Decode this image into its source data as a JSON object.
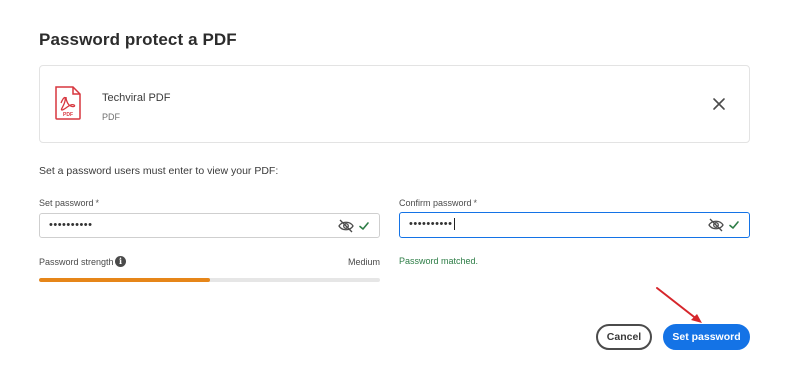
{
  "dialog": {
    "title": "Password protect a PDF"
  },
  "file": {
    "name": "Techviral PDF",
    "type": "PDF",
    "icon": "pdf-file-icon"
  },
  "instruction": "Set a password users must enter to view your PDF:",
  "set_password": {
    "label": "Set password",
    "required_mark": "*",
    "value": "••••••••••",
    "valid": true
  },
  "confirm_password": {
    "label": "Confirm password",
    "required_mark": "*",
    "value": "••••••••••",
    "focused": true,
    "valid": true
  },
  "strength": {
    "label": "Password strength",
    "info_icon": "i",
    "value_label": "Medium",
    "level": 0.5
  },
  "match_message": "Password matched.",
  "buttons": {
    "cancel": "Cancel",
    "submit": "Set password"
  },
  "colors": {
    "accent": "#1473e6",
    "strength_medium": "#e68619",
    "success": "#2d7d46",
    "annotation_arrow": "#d6262b"
  }
}
